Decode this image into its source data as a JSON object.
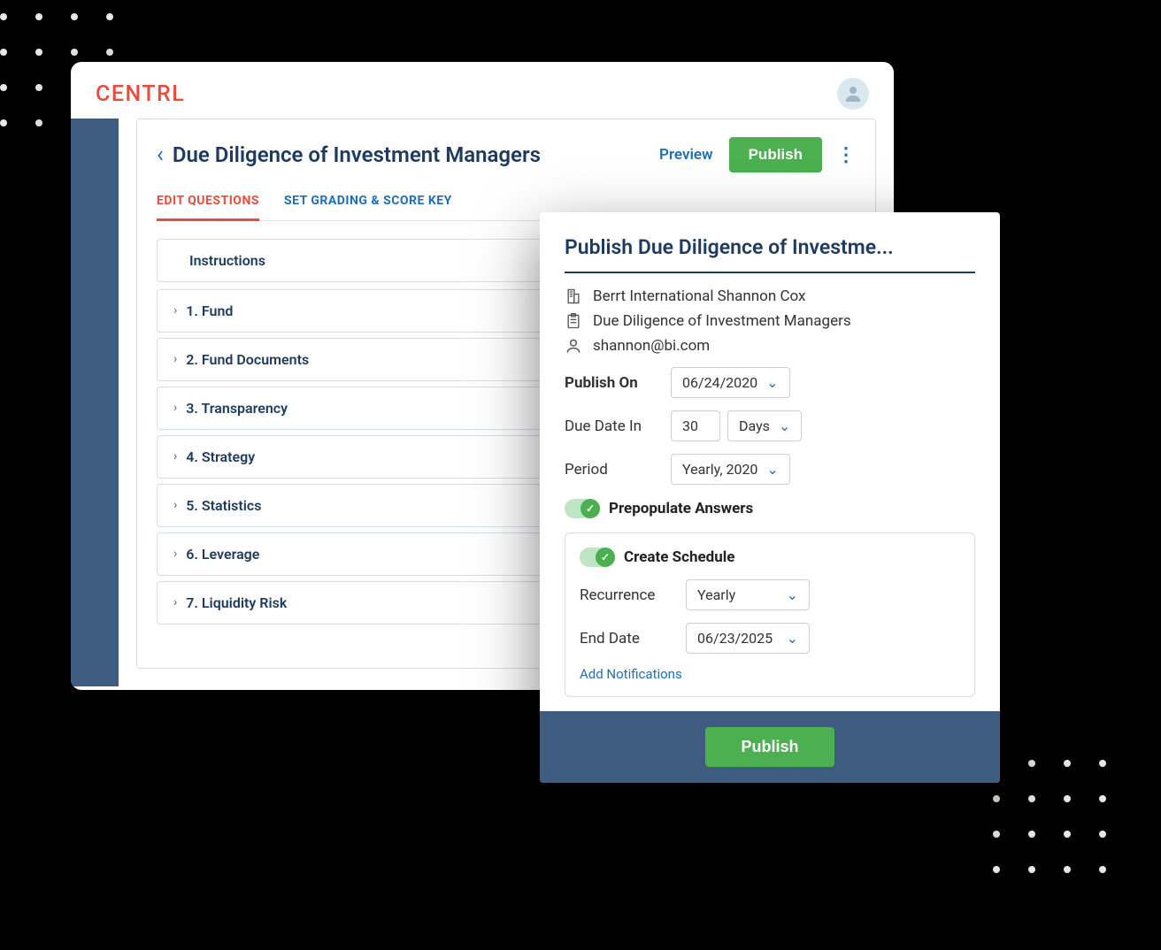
{
  "header": {
    "logo": "CENTRL"
  },
  "page": {
    "title": "Due Diligence of Investment Managers",
    "preview": "Preview",
    "publish": "Publish",
    "tabs": {
      "edit": "EDIT QUESTIONS",
      "grading": "SET GRADING & SCORE KEY"
    },
    "instructions": "Instructions",
    "sections": [
      "1. Fund",
      "2. Fund Documents",
      "3. Transparency",
      "4. Strategy",
      "5. Statistics",
      "6. Leverage",
      "7. Liquidity Risk"
    ]
  },
  "modal": {
    "title": "Publish Due Diligence of Investme...",
    "company": "Berrt International Shannon Cox",
    "project": "Due Diligence of Investment Managers",
    "email": "shannon@bi.com",
    "publishOnLabel": "Publish On",
    "publishOn": "06/24/2020",
    "dueDateLabel": "Due Date In",
    "dueDateValue": "30",
    "dueDateUnit": "Days",
    "periodLabel": "Period",
    "period": "Yearly, 2020",
    "prepopulate": "Prepopulate Answers",
    "createSchedule": "Create Schedule",
    "recurrenceLabel": "Recurrence",
    "recurrence": "Yearly",
    "endDateLabel": "End Date",
    "endDate": "06/23/2025",
    "addNotifications": "Add Notifications",
    "publishButton": "Publish"
  }
}
